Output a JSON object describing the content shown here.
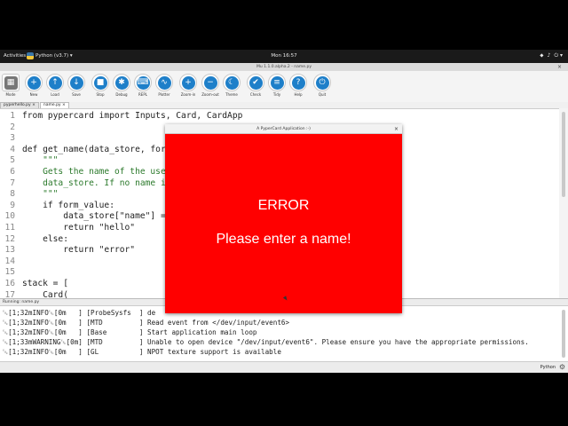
{
  "topbar": {
    "activities": "Activities",
    "app_menu": "Python (v3.7) ▾",
    "clock": "Mon 16:57",
    "status_icons": [
      "⬥",
      "♪",
      "⏻ ▾"
    ]
  },
  "mu_window": {
    "title": "Mu 1.1.0.alpha.2 - name.py",
    "close": "×"
  },
  "toolbar": [
    {
      "label": "Mode",
      "icon": "▦"
    },
    {
      "label": "New",
      "icon": "+"
    },
    {
      "label": "Load",
      "icon": "↑"
    },
    {
      "label": "Save",
      "icon": "↓"
    },
    {
      "label": "Stop",
      "icon": "■"
    },
    {
      "label": "Debug",
      "icon": "✱"
    },
    {
      "label": "REPL",
      "icon": "⌨"
    },
    {
      "label": "Plotter",
      "icon": "∿"
    },
    {
      "label": "Zoom-in",
      "icon": "+"
    },
    {
      "label": "Zoom-out",
      "icon": "−"
    },
    {
      "label": "Theme",
      "icon": "☾"
    },
    {
      "label": "Check",
      "icon": "✔"
    },
    {
      "label": "Tidy",
      "icon": "≡"
    },
    {
      "label": "Help",
      "icon": "?"
    },
    {
      "label": "Quit",
      "icon": "⏻"
    }
  ],
  "tabs": [
    "pyperhello.py ×",
    "name.py ×"
  ],
  "editor": {
    "lines": [
      {
        "n": "1",
        "code": "from pypercard import Inputs, Card, CardApp"
      },
      {
        "n": "2",
        "code": ""
      },
      {
        "n": "3",
        "code": ""
      },
      {
        "n": "4",
        "code": "def get_name(data_store, for"
      },
      {
        "n": "5",
        "code": "    \"\"\""
      },
      {
        "n": "6",
        "code": "    Gets the name of the use"
      },
      {
        "n": "7",
        "code": "    data_store. If no name i"
      },
      {
        "n": "8",
        "code": "    \"\"\""
      },
      {
        "n": "9",
        "code": "    if form_value:"
      },
      {
        "n": "10",
        "code": "        data_store[\"name\"] ="
      },
      {
        "n": "11",
        "code": "        return \"hello\""
      },
      {
        "n": "12",
        "code": "    else:"
      },
      {
        "n": "13",
        "code": "        return \"error\""
      },
      {
        "n": "14",
        "code": ""
      },
      {
        "n": "15",
        "code": ""
      },
      {
        "n": "16",
        "code": "stack = ["
      },
      {
        "n": "17",
        "code": "    Card("
      }
    ]
  },
  "runner": {
    "label": "Running: name.py",
    "lines": [
      "␛[1;32mINFO␛[0m   ] [ProbeSysfs  ] de",
      "␛[1;32mINFO␛[0m   ] [MTD         ] Read event from </dev/input/event6>",
      "␛[1;32mINFO␛[0m   ] [Base        ] Start application main loop",
      "␛[1;33mWARNING␛[0m] [MTD         ] Unable to open device \"/dev/input/event6\". Please ensure you have the appropriate permissions.",
      "␛[1;32mINFO␛[0m   ] [GL          ] NPOT texture support is available"
    ]
  },
  "statusbar": {
    "mode": "Python",
    "gear": "⚙"
  },
  "app_window": {
    "title": "A PyperCard Application :-)",
    "close": "×",
    "error": "ERROR",
    "message": "Please enter a name!"
  }
}
